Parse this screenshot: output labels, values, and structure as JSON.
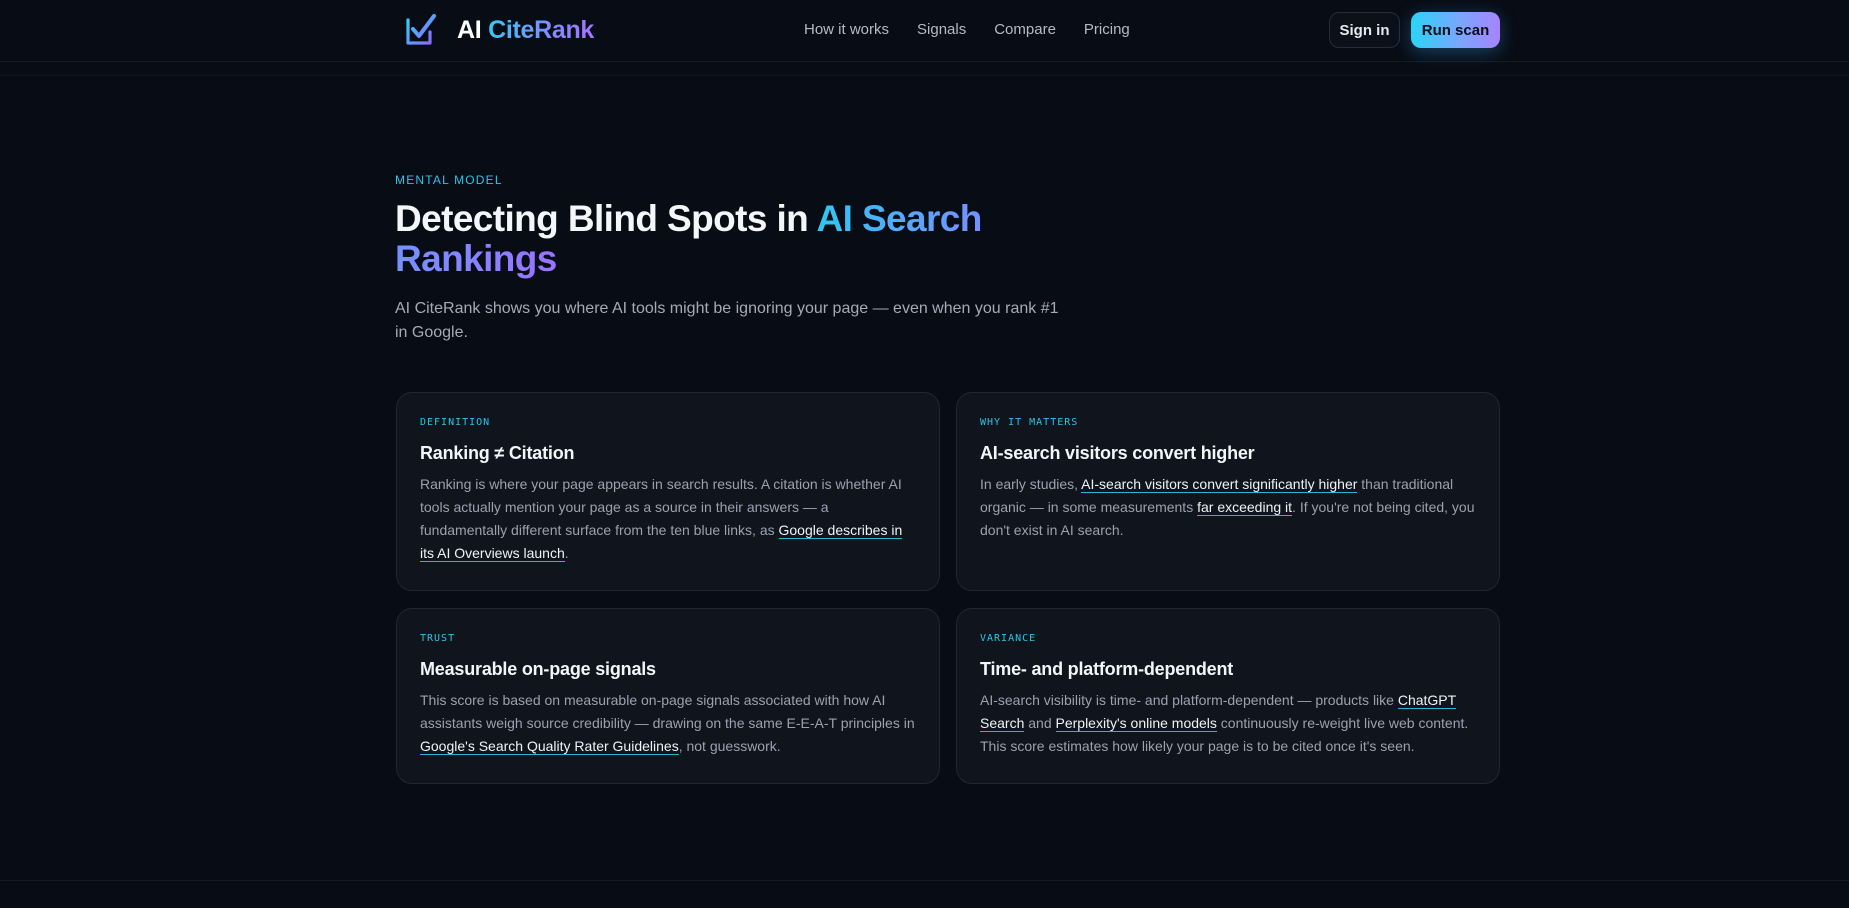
{
  "header": {
    "brand": {
      "ai": "AI",
      "name": "CiteRank"
    },
    "nav": [
      {
        "label": "How it works"
      },
      {
        "label": "Signals"
      },
      {
        "label": "Compare"
      },
      {
        "label": "Pricing"
      }
    ],
    "signin_label": "Sign in",
    "runscan_label": "Run scan"
  },
  "hero": {
    "eyebrow": "MENTAL MODEL",
    "title_plain": "Detecting Blind Spots in ",
    "title_highlight": "AI Search Rankings",
    "subtitle": "AI CiteRank shows you where AI tools might be ignoring your page — even when you rank #1 in Google."
  },
  "cards": [
    {
      "tag": "DEFINITION",
      "title": "Ranking ≠ Citation",
      "body": [
        {
          "text": "Ranking is where your page appears in search results. A citation is whether AI tools actually mention your page as a source in their answers — a fundamentally different surface from the ten blue links, as "
        },
        {
          "link": "Google describes in its AI Overviews launch"
        },
        {
          "text": "."
        }
      ]
    },
    {
      "tag": "WHY IT MATTERS",
      "title": "AI-search visitors convert higher",
      "body": [
        {
          "text": "In early studies, "
        },
        {
          "link": "AI-search visitors convert significantly higher"
        },
        {
          "text": " than traditional organic — in some measurements "
        },
        {
          "link": "far exceeding it"
        },
        {
          "text": ". If you're not being cited, you don't exist in AI search."
        }
      ]
    },
    {
      "tag": "TRUST",
      "title": "Measurable on-page signals",
      "body": [
        {
          "text": "This score is based on measurable on-page signals associated with how AI assistants weigh source credibility — drawing on the same E-E-A-T principles in "
        },
        {
          "link": "Google's Search Quality Rater Guidelines"
        },
        {
          "text": ", not guesswork."
        }
      ]
    },
    {
      "tag": "VARIANCE",
      "title": "Time- and platform-dependent",
      "body": [
        {
          "text": "AI-search visibility is time- and platform-dependent — products like "
        },
        {
          "link": "ChatGPT Search"
        },
        {
          "text": " and "
        },
        {
          "link": "Perplexity's online models"
        },
        {
          "text": " continuously re-weight live web content. This score estimates how likely your page is to be cited once it's seen."
        }
      ]
    }
  ],
  "colors": {
    "background": "#080c14",
    "accent_cyan": "#2bc4ec",
    "accent_violet": "#9b72ff"
  },
  "icons": {
    "brand": "checkbox-check-icon"
  }
}
